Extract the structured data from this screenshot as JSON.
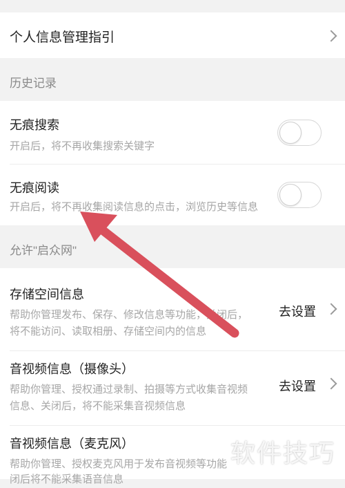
{
  "privacy_guide": {
    "label": "个人信息管理指引"
  },
  "history_section": {
    "header": "历史记录"
  },
  "incognito_search": {
    "title": "无痕搜索",
    "desc": "开启后，将不再收集搜索关键字",
    "enabled": false
  },
  "incognito_read": {
    "title": "无痕阅读",
    "desc": "开启后，将不再收集阅读信息的点击，浏览历史等信息",
    "enabled": false
  },
  "allow_section": {
    "header": "允许\"启众网\""
  },
  "storage": {
    "title": "存储空间信息",
    "desc_line1": "帮助你管理发布、保存、修改信息等功能，关闭后，",
    "desc_line2": "将不能访问、读取相册、存储空间内的信息",
    "action": "去设置"
  },
  "camera": {
    "title": "音视频信息（摄像头）",
    "desc_line1": "帮助你管理、授权通过录制、拍摄等方式收集音视频",
    "desc_line2": "信息、关闭后，将不能采集音视频信息",
    "action": "去设置"
  },
  "microphone": {
    "title": "音视频信息（麦克风）",
    "desc_line1": "帮助你管理、授权麦克风用于发布音视频等功能",
    "desc_line2": "闭后将不能采集语音信息"
  },
  "watermark": "软件技巧",
  "colors": {
    "arrow": "#d9505c",
    "background": "#f2f2f2",
    "card": "#ffffff"
  }
}
